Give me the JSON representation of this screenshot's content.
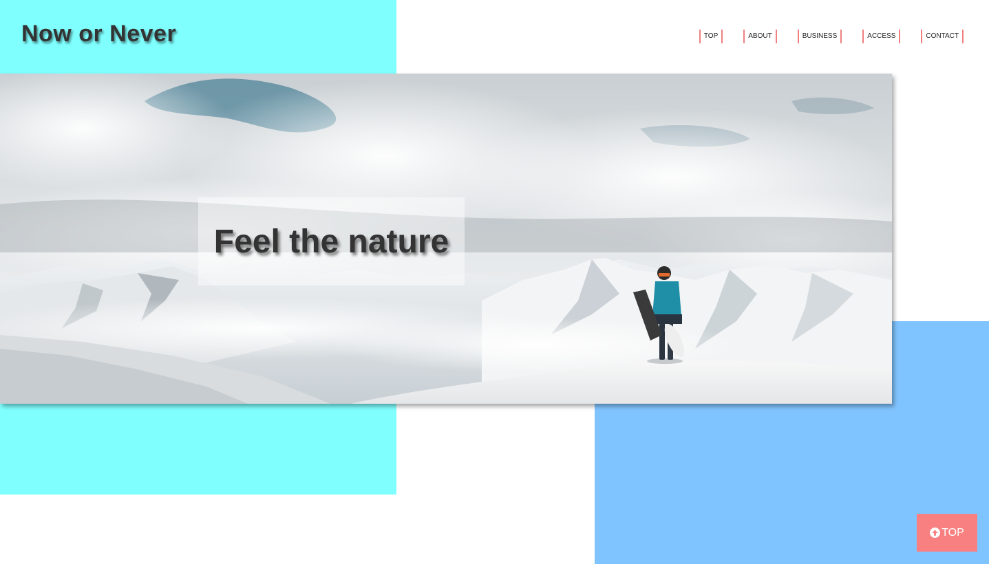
{
  "header": {
    "site_title": "Now or Never",
    "nav": [
      {
        "label": "TOP"
      },
      {
        "label": "ABOUT"
      },
      {
        "label": "BUSINESS"
      },
      {
        "label": "ACCESS"
      },
      {
        "label": "CONTACT"
      }
    ]
  },
  "hero": {
    "catch_copy": "Feel the nature",
    "image_subject": "snowboarder standing on a snowy mountain ridge"
  },
  "page_top_button": {
    "icon": "arrow-circle-up-icon",
    "label": "TOP"
  },
  "colors": {
    "deco_cyan": "#80ffff",
    "deco_blue": "#80c4ff",
    "nav_border": "#f08080",
    "page_top_bg": "#f88080",
    "text": "#333333"
  }
}
